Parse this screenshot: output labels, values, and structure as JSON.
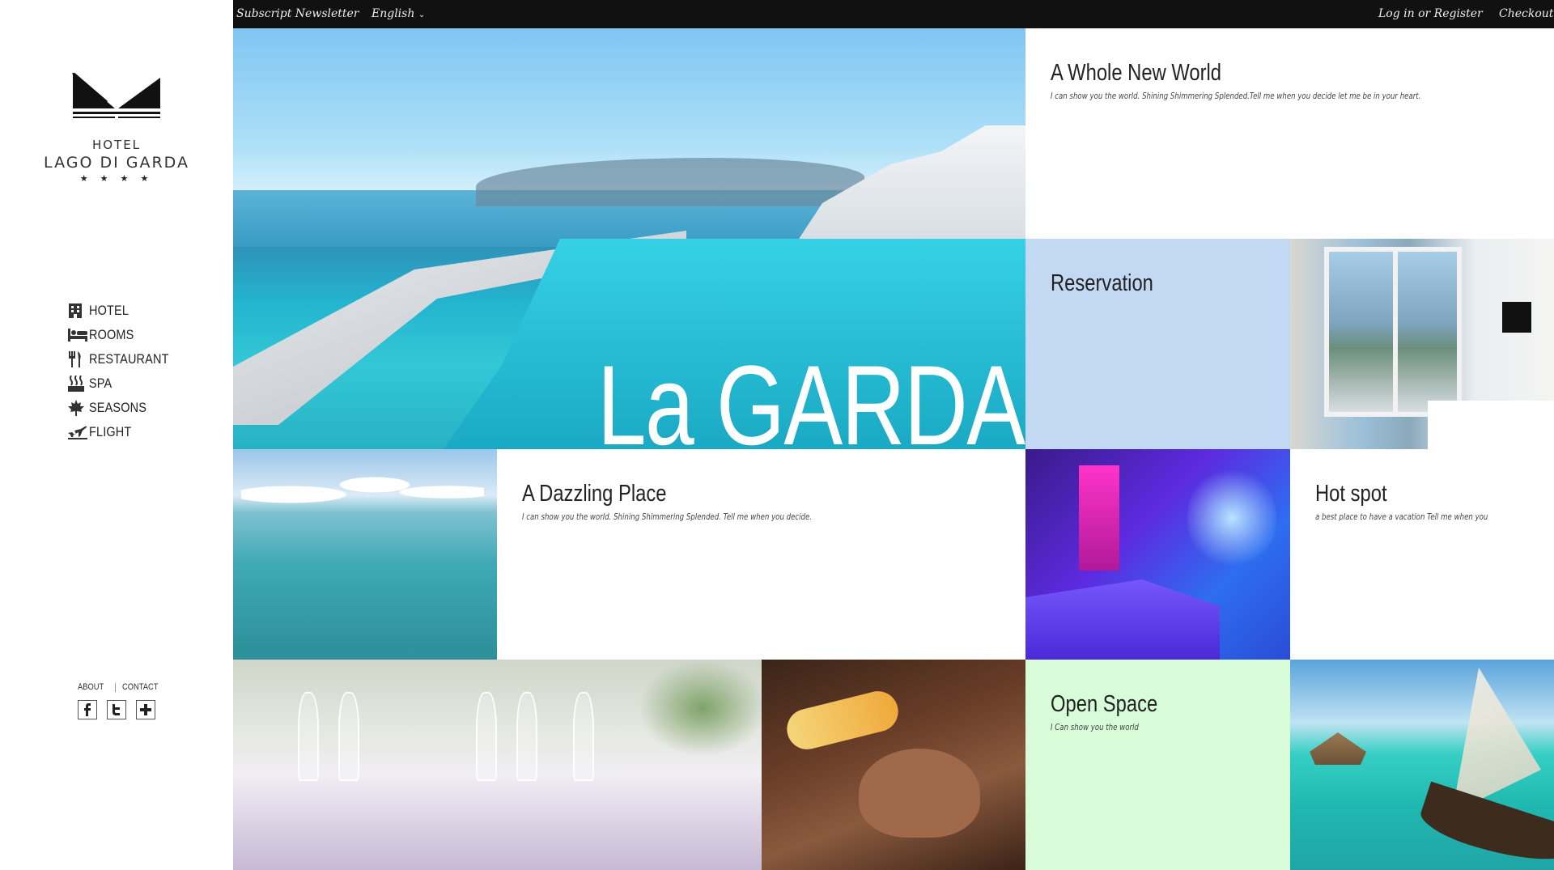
{
  "topbar": {
    "newsletter": "Subscript Newsletter",
    "language": "English",
    "login": "Log in or Register",
    "checkout": "Checkout"
  },
  "logo": {
    "line1": "HOTEL",
    "line2": "LAGO DI GARDA",
    "stars": "★ ★ ★ ★"
  },
  "nav": {
    "items": [
      {
        "label": "HOTEL",
        "icon": "building-icon"
      },
      {
        "label": "ROOMS",
        "icon": "bed-icon"
      },
      {
        "label": "RESTAURANT",
        "icon": "cutlery-icon"
      },
      {
        "label": "SPA",
        "icon": "spa-icon"
      },
      {
        "label": "SEASONS",
        "icon": "maple-leaf-icon"
      },
      {
        "label": "FLIGHT",
        "icon": "plane-icon"
      }
    ]
  },
  "footer": {
    "about": "ABOUT",
    "contact": "CONTACT",
    "social": [
      "facebook-icon",
      "twitter-icon",
      "plus-icon"
    ]
  },
  "hero": {
    "title": "La GARDA"
  },
  "tiles": {
    "world": {
      "title": "A Whole New World",
      "text": "I can show you the world. Shining Shimmering Splended.Tell me when you decide let me be in your heart."
    },
    "reservation": {
      "title": "Reservation"
    },
    "dazzling": {
      "title": "A Dazzling Place",
      "text": "I can show you the world. Shining Shimmering Splended. Tell me when you decide."
    },
    "hotspot": {
      "title": "Hot spot",
      "text": "a best place to have a vacation Tell me when you"
    },
    "openspace": {
      "title": "Open Space",
      "text": "I Can show you the world"
    }
  },
  "colors": {
    "topbar": "#111111",
    "reservation_bg": "#c3d8f2",
    "openspace_bg": "#d7fcd7"
  }
}
